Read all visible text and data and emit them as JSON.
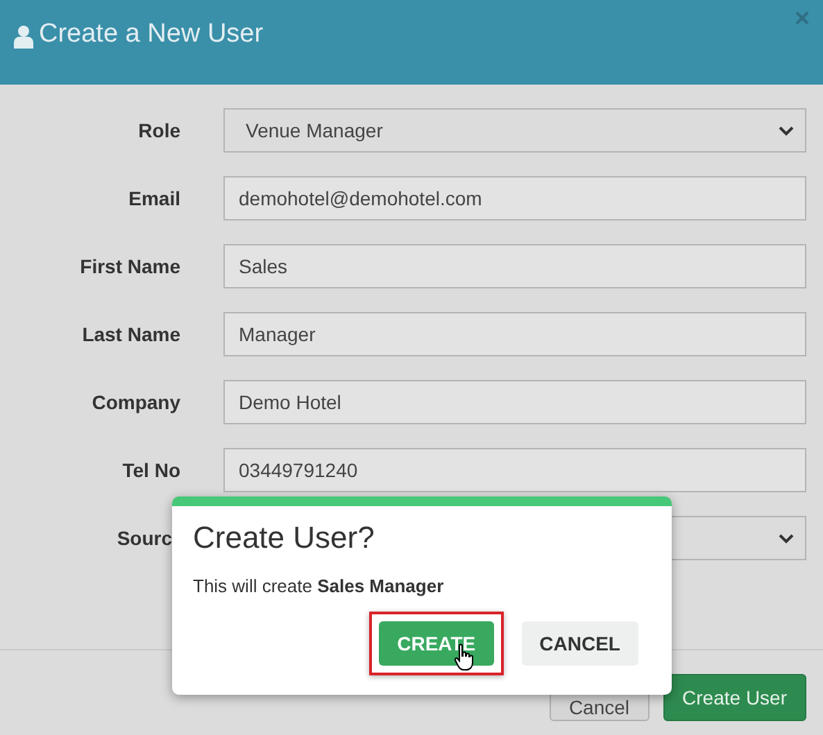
{
  "window": {
    "title": "Create a New User"
  },
  "form": {
    "fields": [
      {
        "label": "Role",
        "kind": "select",
        "value": "Venue Manager"
      },
      {
        "label": "Email",
        "kind": "text",
        "value": "demohotel@demohotel.com"
      },
      {
        "label": "First Name",
        "kind": "text",
        "value": "Sales"
      },
      {
        "label": "Last Name",
        "kind": "text",
        "value": "Manager"
      },
      {
        "label": "Company",
        "kind": "text",
        "value": "Demo Hotel"
      },
      {
        "label": "Tel No",
        "kind": "text",
        "value": "03449791240"
      },
      {
        "label": "Sourc",
        "kind": "select"
      }
    ]
  },
  "footer": {
    "buttons": [
      {
        "label": "Cancel",
        "kind": "default"
      },
      {
        "label": "Create User",
        "kind": "primary"
      }
    ]
  },
  "dialog": {
    "title": "Create User?",
    "message": "This will create **Sales Manager**",
    "buttons": [
      {
        "label": "CREATE",
        "kind": "confirm",
        "highlighted": true
      },
      {
        "label": "CANCEL",
        "kind": "cancel",
        "highlighted": false
      }
    ]
  }
}
